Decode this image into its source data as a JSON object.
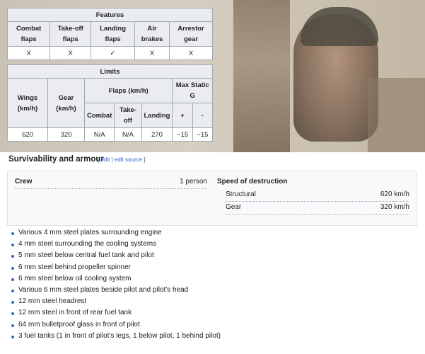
{
  "features": {
    "title": "Features",
    "headers": [
      "Combat flaps",
      "Take-off flaps",
      "Landing flaps",
      "Air brakes",
      "Arrestor gear"
    ],
    "values": [
      "X",
      "X",
      "✓",
      "X",
      "X"
    ]
  },
  "limits": {
    "title": "Limits",
    "wings_header": "Wings (km/h)",
    "gear_header": "Gear (km/h)",
    "flaps_header": "Flaps (km/h)",
    "max_static_header": "Max Static G",
    "combat_header": "Combat",
    "takeoff_header": "Take-off",
    "landing_header": "Landing",
    "plus_header": "+",
    "minus_header": "-",
    "values": [
      "620",
      "320",
      "N/A",
      "N/A",
      "270",
      "~15",
      "~15"
    ]
  },
  "survivability": {
    "title": "Survivability and armour",
    "edit_open": "[",
    "edit_label": "edit",
    "edit_sep": "|",
    "edit_source_label": "edit source",
    "edit_close": "]",
    "crew_label": "Crew",
    "crew_value": "1 person",
    "speed_label": "Speed of destruction",
    "structural_label": "Structural",
    "structural_value": "620 km/h",
    "gear_label": "Gear",
    "gear_value": "320 km/h",
    "armour_items": [
      "Various 4 mm steel plates surrounding engine",
      "4 mm steel surrounding the cooling systems",
      "5 mm steel below central fuel tank and pilot",
      "6 mm steel behind propeller spinner",
      "6 mm steel below oil cooling system",
      "Various 6 mm steel plates beside pilot and pilot's head",
      "12 mm steel headrest",
      "12 mm steel in front of rear fuel tank",
      "64 mm bulletproof glass in front of pilot",
      "3 fuel tanks (1 in front of pilot's legs, 1 below pilot, 1 behind pilot)"
    ]
  },
  "colors": {
    "link": "#3366cc",
    "header_bg": "#eaecf0",
    "border": "#a2a9b1"
  }
}
